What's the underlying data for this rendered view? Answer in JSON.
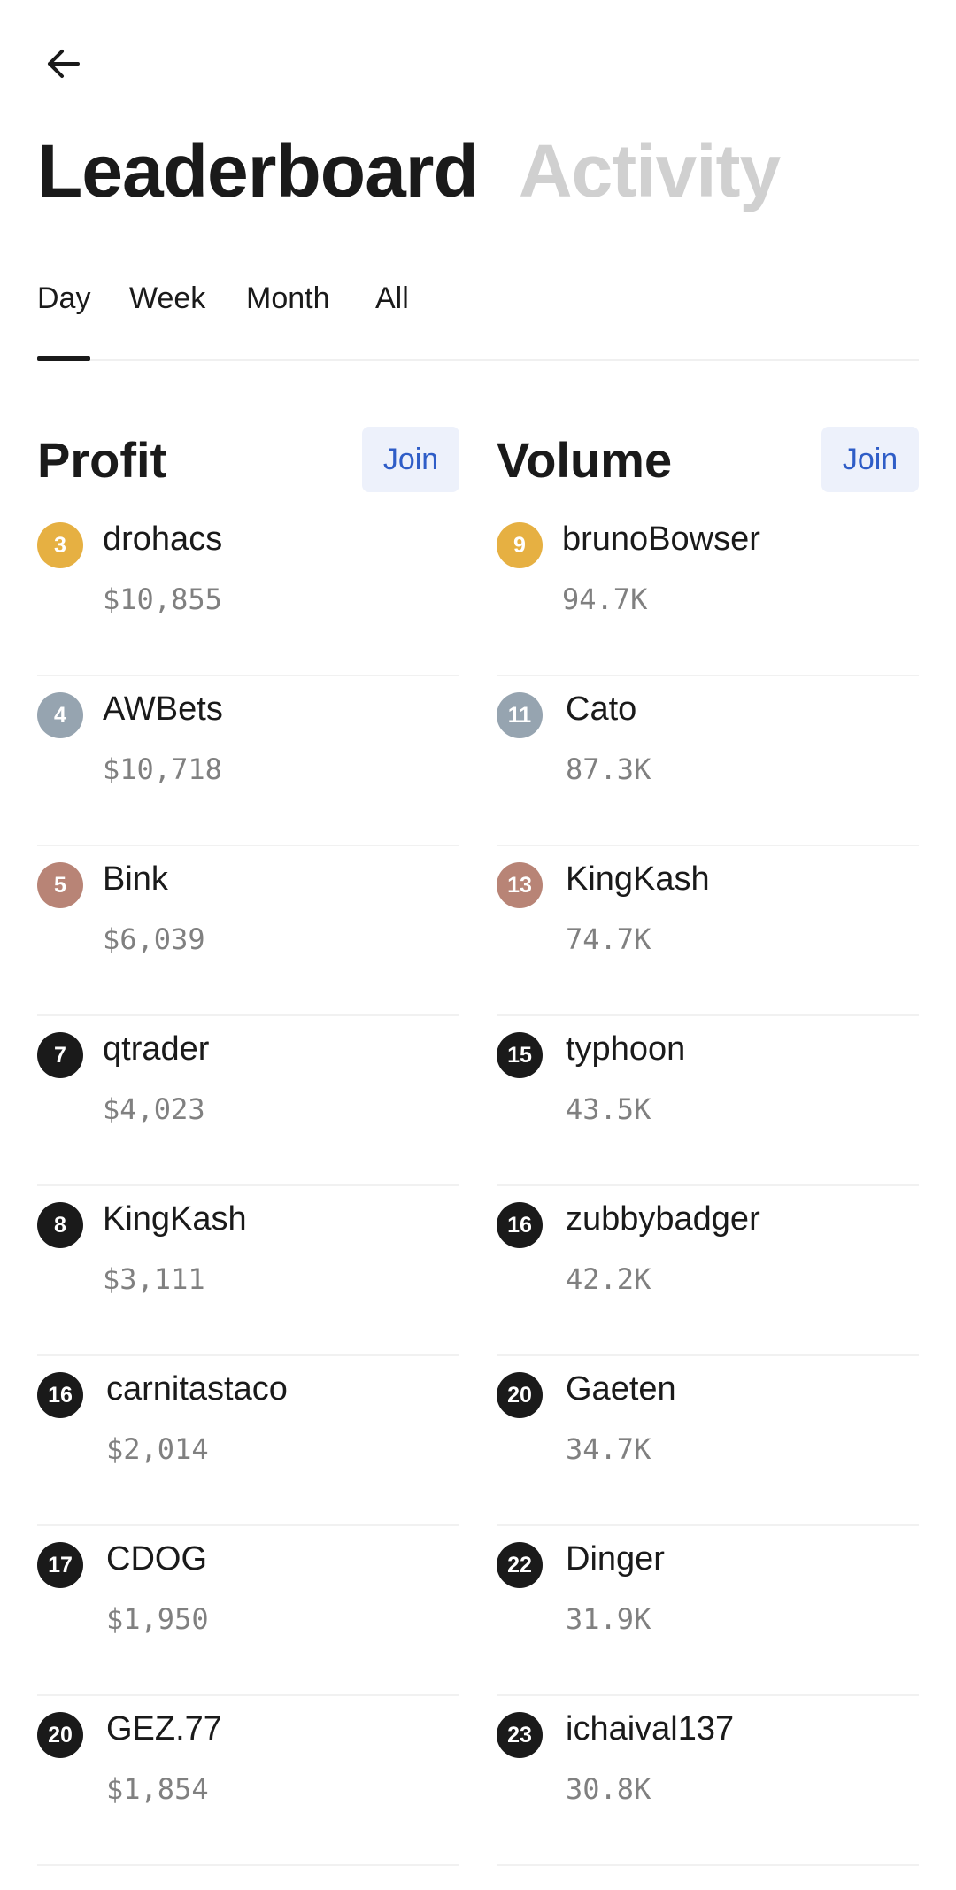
{
  "nav": {
    "back_icon": "arrow-left-icon"
  },
  "title": {
    "main": "Leaderboard",
    "alt": "Activity"
  },
  "tabs": [
    {
      "label": "Day",
      "active": true
    },
    {
      "label": "Week",
      "active": false
    },
    {
      "label": "Month",
      "active": false
    },
    {
      "label": "All",
      "active": false
    }
  ],
  "profit": {
    "title": "Profit",
    "join_label": "Join",
    "rows": [
      {
        "rank": "3",
        "medal": "gold",
        "name": "drohacs",
        "value": "$10,855"
      },
      {
        "rank": "4",
        "medal": "silver",
        "name": "AWBets",
        "value": "$10,718"
      },
      {
        "rank": "5",
        "medal": "bronze",
        "name": "Bink",
        "value": "$6,039"
      },
      {
        "rank": "7",
        "medal": "black",
        "name": "qtrader",
        "value": "$4,023"
      },
      {
        "rank": "8",
        "medal": "black",
        "name": "KingKash",
        "value": "$3,111"
      },
      {
        "rank": "16",
        "medal": "black",
        "name": "carnitastaco",
        "value": "$2,014"
      },
      {
        "rank": "17",
        "medal": "black",
        "name": "CDOG",
        "value": "$1,950"
      },
      {
        "rank": "20",
        "medal": "black",
        "name": "GEZ.77",
        "value": "$1,854"
      }
    ]
  },
  "volume": {
    "title": "Volume",
    "join_label": "Join",
    "rows": [
      {
        "rank": "9",
        "medal": "gold",
        "name": "brunoBowser",
        "value": "94.7K"
      },
      {
        "rank": "11",
        "medal": "silver",
        "name": "Cato",
        "value": "87.3K"
      },
      {
        "rank": "13",
        "medal": "bronze",
        "name": "KingKash",
        "value": "74.7K"
      },
      {
        "rank": "15",
        "medal": "black",
        "name": "typhoon",
        "value": "43.5K"
      },
      {
        "rank": "16",
        "medal": "black",
        "name": "zubbybadger",
        "value": "42.2K"
      },
      {
        "rank": "20",
        "medal": "black",
        "name": "Gaeten",
        "value": "34.7K"
      },
      {
        "rank": "22",
        "medal": "black",
        "name": "Dinger",
        "value": "31.9K"
      },
      {
        "rank": "23",
        "medal": "black",
        "name": "ichaival137",
        "value": "30.8K"
      }
    ]
  },
  "colors": {
    "gold": "#e6b042",
    "silver": "#96a4b0",
    "bronze": "#b88476",
    "black": "#1a1a1a",
    "accent": "#2f5dc7"
  }
}
